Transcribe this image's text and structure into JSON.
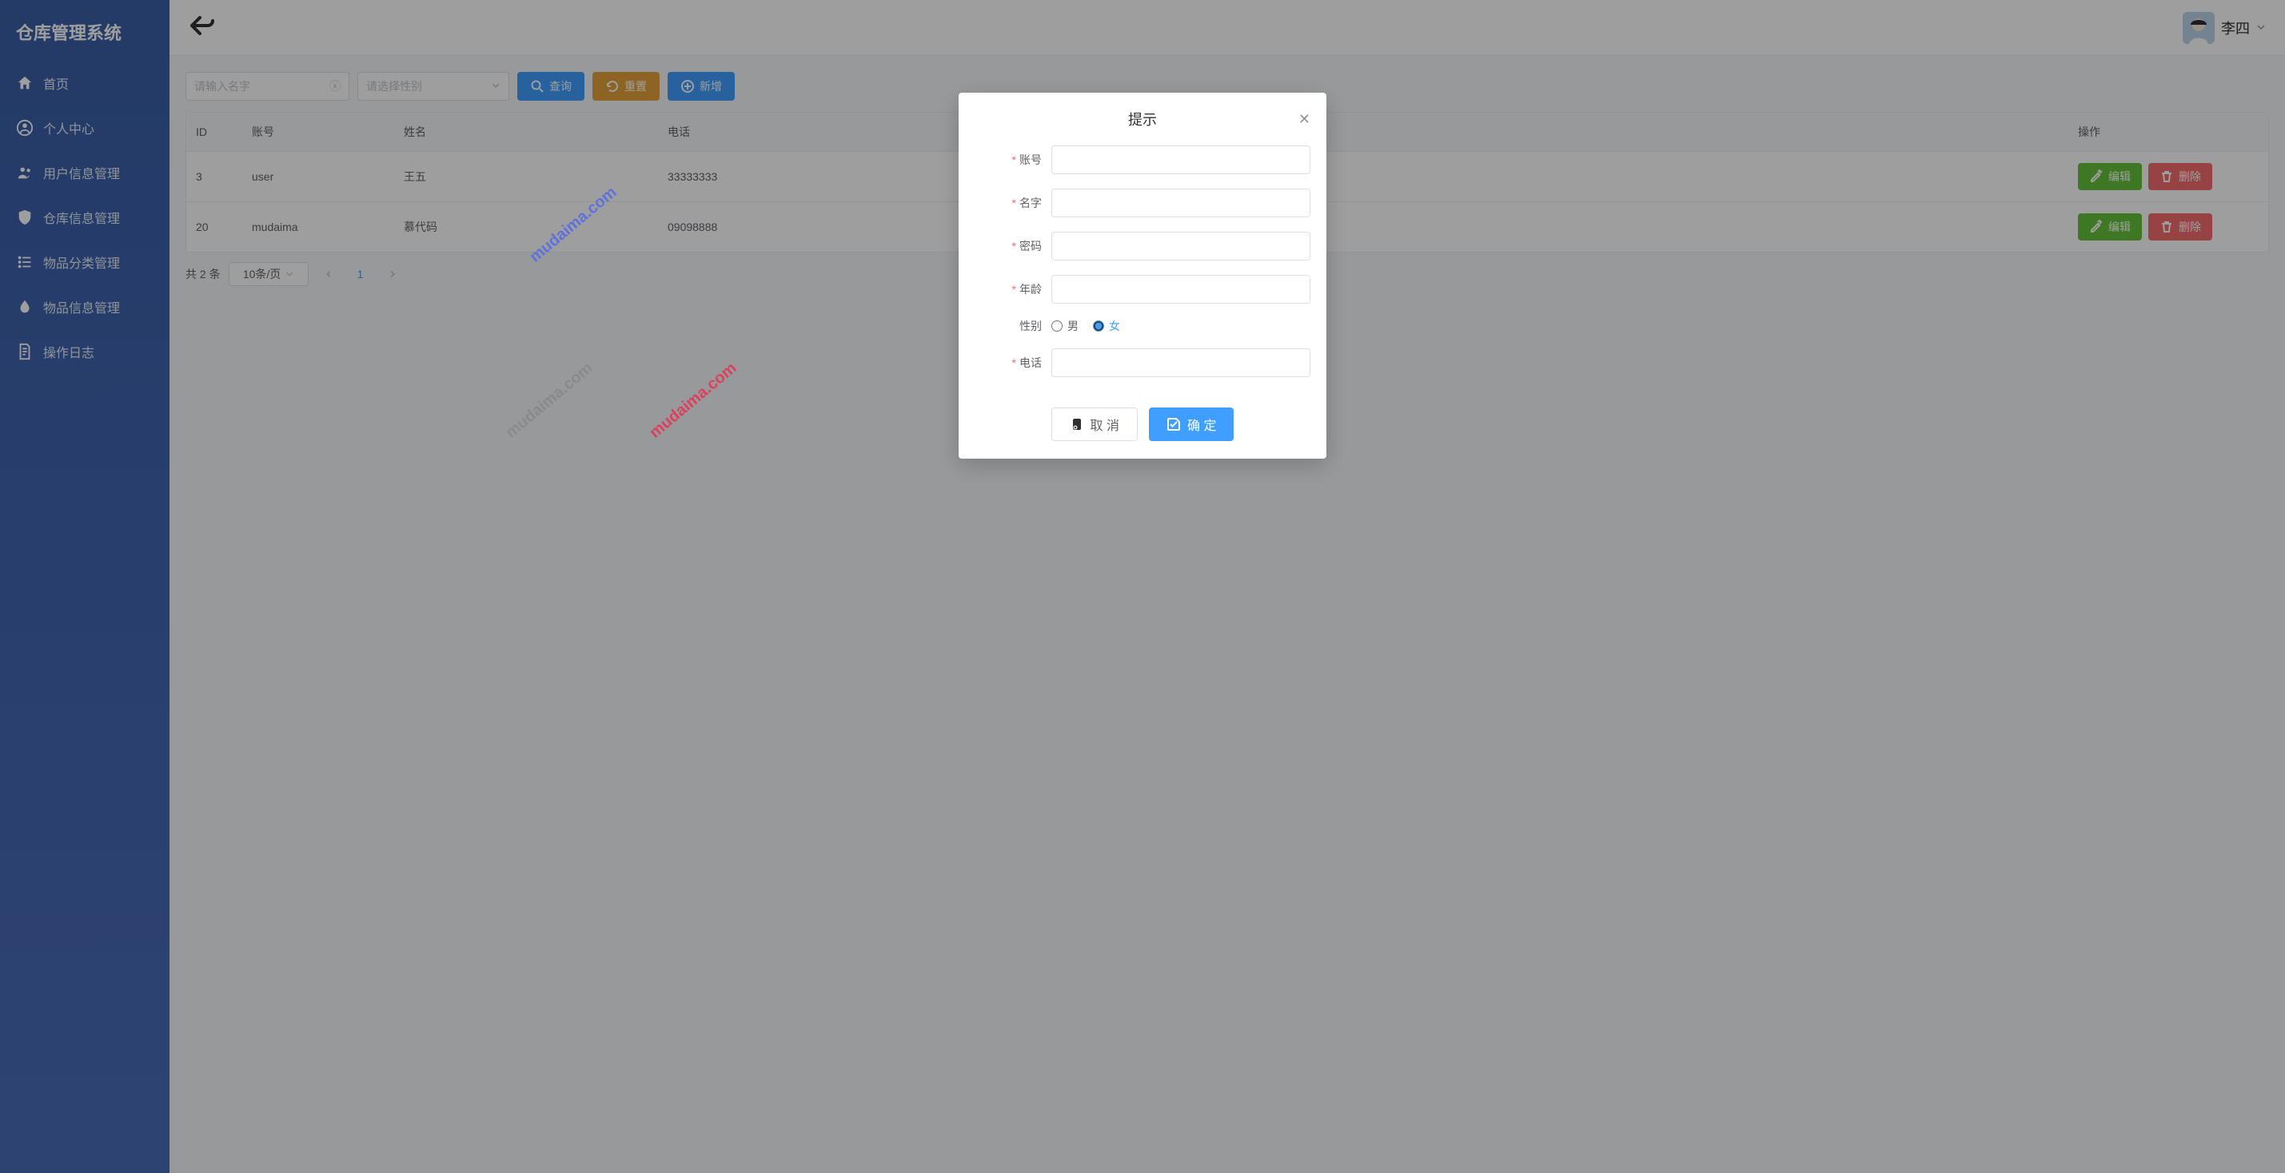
{
  "app": {
    "title": "仓库管理系统"
  },
  "sidebar": {
    "items": [
      {
        "label": "首页"
      },
      {
        "label": "个人中心"
      },
      {
        "label": "用户信息管理"
      },
      {
        "label": "仓库信息管理"
      },
      {
        "label": "物品分类管理"
      },
      {
        "label": "物品信息管理"
      },
      {
        "label": "操作日志"
      }
    ]
  },
  "header": {
    "username": "李四"
  },
  "search": {
    "name_placeholder": "请输入名字",
    "gender_placeholder": "请选择性别"
  },
  "toolbar": {
    "query": "查询",
    "reset": "重置",
    "add": "新增"
  },
  "table": {
    "columns": {
      "id": "ID",
      "account": "账号",
      "name": "姓名",
      "phone": "电话",
      "ops": "操作"
    },
    "rows": [
      {
        "id": "3",
        "account": "user",
        "name": "王五",
        "phone": "33333333"
      },
      {
        "id": "20",
        "account": "mudaima",
        "name": "慕代码",
        "phone": "09098888"
      }
    ],
    "op_edit": "编辑",
    "op_delete": "删除"
  },
  "pagination": {
    "total_text": "共 2 条",
    "page_size": "10条/页",
    "current": "1"
  },
  "dialog": {
    "title": "提示",
    "fields": {
      "account": "账号",
      "name": "名字",
      "password": "密码",
      "age": "年龄",
      "gender": "性别",
      "phone": "电话"
    },
    "gender_options": {
      "male": "男",
      "female": "女"
    },
    "gender_selected": "female",
    "cancel": "取 消",
    "confirm": "确 定"
  },
  "watermark": "mudaima.com"
}
